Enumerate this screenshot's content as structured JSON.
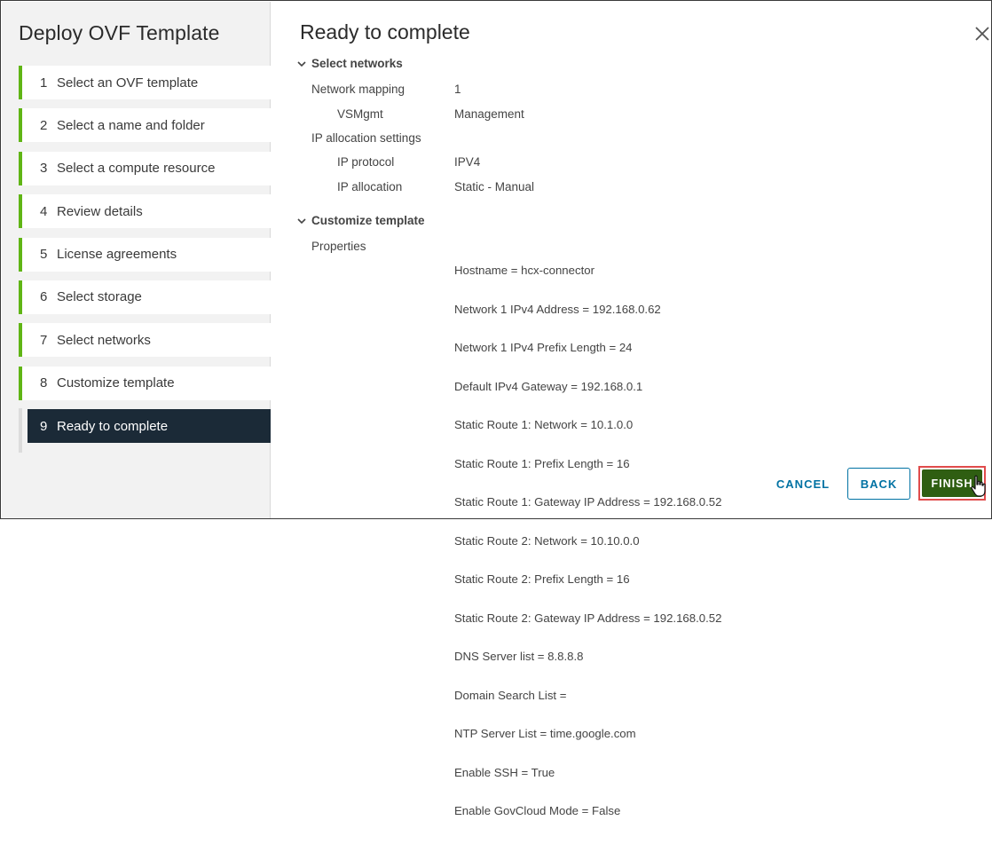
{
  "sidebar": {
    "title": "Deploy OVF Template",
    "steps": [
      {
        "num": "1",
        "label": "Select an OVF template"
      },
      {
        "num": "2",
        "label": "Select a name and folder"
      },
      {
        "num": "3",
        "label": "Select a compute resource"
      },
      {
        "num": "4",
        "label": "Review details"
      },
      {
        "num": "5",
        "label": "License agreements"
      },
      {
        "num": "6",
        "label": "Select storage"
      },
      {
        "num": "7",
        "label": "Select networks"
      },
      {
        "num": "8",
        "label": "Customize template"
      },
      {
        "num": "9",
        "label": "Ready to complete"
      }
    ],
    "active_step": 9
  },
  "main": {
    "title": "Ready to complete",
    "networks": {
      "heading": "Select networks",
      "network_mapping_label": "Network mapping",
      "network_mapping_value": "1",
      "vsmgmt_label": "VSMgmt",
      "vsmgmt_value": "Management",
      "ip_alloc_settings_label": "IP allocation settings",
      "ip_protocol_label": "IP protocol",
      "ip_protocol_value": "IPV4",
      "ip_allocation_label": "IP allocation",
      "ip_allocation_value": "Static - Manual"
    },
    "customize": {
      "heading": "Customize template",
      "properties_label": "Properties",
      "properties": [
        "Hostname = hcx-connector",
        "Network 1 IPv4 Address = 192.168.0.62",
        "Network 1 IPv4 Prefix Length = 24",
        "Default IPv4 Gateway = 192.168.0.1",
        "Static Route 1: Network = 10.1.0.0",
        "Static Route 1: Prefix Length = 16",
        "Static Route 1: Gateway IP Address = 192.168.0.52",
        "Static Route 2: Network = 10.10.0.0",
        "Static Route 2: Prefix Length = 16",
        "Static Route 2: Gateway IP Address = 192.168.0.52",
        "DNS Server list = 8.8.8.8",
        "Domain Search List =",
        "NTP Server List = time.google.com",
        "Enable SSH = True",
        "Enable GovCloud Mode = False"
      ]
    }
  },
  "footer": {
    "cancel": "CANCEL",
    "back": "BACK",
    "finish": "FINISH"
  },
  "icons": {
    "close": "close-icon",
    "chevron": "chevron-down-icon",
    "cursor": "hand-pointer-icon"
  },
  "colors": {
    "step_accent": "#60b515",
    "active_step_bg": "#1b2a37",
    "link_blue": "#0072a3",
    "finish_bg": "#2f5e12",
    "highlight_red": "#e04c4c"
  }
}
